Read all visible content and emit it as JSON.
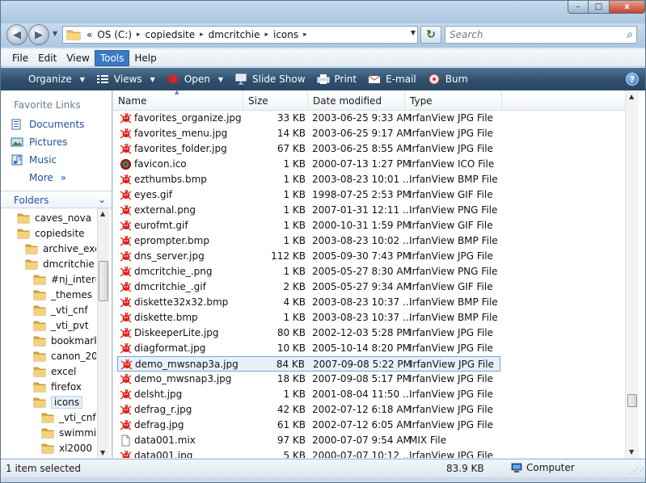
{
  "window": {
    "controls": {
      "minimize": "–",
      "maximize": "□",
      "close": "x"
    }
  },
  "nav": {
    "back_glyph": "◀",
    "forward_glyph": "▶",
    "recent_glyph": "▼",
    "breadcrumbs": [
      "«",
      "OS (C:)",
      "copiedsite",
      "dmcritchie",
      "icons"
    ],
    "crumb_sep": "▸",
    "address_dropdown": "▼",
    "refresh_glyph": "↻",
    "search_placeholder": "Search",
    "search_icon": "⌕"
  },
  "menu": {
    "items": [
      {
        "label": "File",
        "active": false
      },
      {
        "label": "Edit",
        "active": false
      },
      {
        "label": "View",
        "active": false
      },
      {
        "label": "Tools",
        "active": true
      },
      {
        "label": "Help",
        "active": false
      }
    ]
  },
  "commands": [
    {
      "label": "Organize",
      "icon": "organize-icon",
      "dropdown": true
    },
    {
      "label": "Views",
      "icon": "views-icon",
      "dropdown": true
    },
    {
      "label": "Open",
      "icon": "irfanview-icon",
      "dropdown": true
    },
    {
      "label": "Slide Show",
      "icon": "slideshow-icon",
      "dropdown": false
    },
    {
      "label": "Print",
      "icon": "printer-icon",
      "dropdown": false
    },
    {
      "label": "E-mail",
      "icon": "email-icon",
      "dropdown": false
    },
    {
      "label": "Burn",
      "icon": "burn-icon",
      "dropdown": false
    }
  ],
  "command_dropdown_glyph": "▼",
  "help_glyph": "?",
  "left": {
    "favorite_links_header": "Favorite Links",
    "favorite_links": [
      {
        "label": "Documents",
        "icon": "documents-icon"
      },
      {
        "label": "Pictures",
        "icon": "pictures-icon"
      },
      {
        "label": "Music",
        "icon": "music-icon"
      }
    ],
    "more_label": "More",
    "more_glyph": "»",
    "folders_header": "Folders",
    "folders_chevron": "⌄",
    "tree": [
      {
        "label": "caves_nova",
        "indent": 1,
        "selected": false
      },
      {
        "label": "copiedsite",
        "indent": 1,
        "selected": false
      },
      {
        "label": "archive_exc",
        "indent": 2,
        "selected": false
      },
      {
        "label": "dmcritchie",
        "indent": 2,
        "selected": false
      },
      {
        "label": "#nj_intere",
        "indent": 3,
        "selected": false
      },
      {
        "label": "_themes",
        "indent": 3,
        "selected": false
      },
      {
        "label": "_vti_cnf",
        "indent": 3,
        "selected": false
      },
      {
        "label": "_vti_pvt",
        "indent": 3,
        "selected": false
      },
      {
        "label": "bookmark",
        "indent": 3,
        "selected": false
      },
      {
        "label": "canon_20",
        "indent": 3,
        "selected": false
      },
      {
        "label": "excel",
        "indent": 3,
        "selected": false
      },
      {
        "label": "firefox",
        "indent": 3,
        "selected": false
      },
      {
        "label": "icons",
        "indent": 3,
        "selected": true
      },
      {
        "label": "_vti_cnf",
        "indent": 4,
        "selected": false
      },
      {
        "label": "swimmi",
        "indent": 4,
        "selected": false
      },
      {
        "label": "xl2000",
        "indent": 4,
        "selected": false
      }
    ]
  },
  "columns": [
    "Name",
    "Size",
    "Date modified",
    "Type"
  ],
  "sort_glyph": "▲",
  "files": [
    {
      "name": "favorites_organize.jpg",
      "size": "33 KB",
      "date": "2003-06-25 9:33 AM",
      "type": "IrfanView JPG File",
      "icon": "irfanview",
      "selected": false
    },
    {
      "name": "favorites_menu.jpg",
      "size": "14 KB",
      "date": "2003-06-25 9:17 AM",
      "type": "IrfanView JPG File",
      "icon": "irfanview",
      "selected": false
    },
    {
      "name": "favorites_folder.jpg",
      "size": "67 KB",
      "date": "2003-06-25 8:55 AM",
      "type": "IrfanView JPG File",
      "icon": "irfanview",
      "selected": false
    },
    {
      "name": "favicon.ico",
      "size": "1 KB",
      "date": "2000-07-13 1:27 PM",
      "type": "IrfanView ICO File",
      "icon": "ico",
      "selected": false
    },
    {
      "name": "ezthumbs.bmp",
      "size": "1 KB",
      "date": "2003-08-23 10:01 ...",
      "type": "IrfanView BMP File",
      "icon": "irfanview",
      "selected": false
    },
    {
      "name": "eyes.gif",
      "size": "1 KB",
      "date": "1998-07-25 2:53 PM",
      "type": "IrfanView GIF File",
      "icon": "irfanview",
      "selected": false
    },
    {
      "name": "external.png",
      "size": "1 KB",
      "date": "2007-01-31 12:11 ...",
      "type": "IrfanView PNG File",
      "icon": "irfanview",
      "selected": false
    },
    {
      "name": "eurofmt.gif",
      "size": "1 KB",
      "date": "2000-10-31 1:59 PM",
      "type": "IrfanView GIF File",
      "icon": "irfanview",
      "selected": false
    },
    {
      "name": "eprompter.bmp",
      "size": "1 KB",
      "date": "2003-08-23 10:02 ...",
      "type": "IrfanView BMP File",
      "icon": "irfanview",
      "selected": false
    },
    {
      "name": "dns_server.jpg",
      "size": "112 KB",
      "date": "2005-09-30 7:43 PM",
      "type": "IrfanView JPG File",
      "icon": "irfanview",
      "selected": false
    },
    {
      "name": "dmcritchie_.png",
      "size": "1 KB",
      "date": "2005-05-27 8:30 AM",
      "type": "IrfanView PNG File",
      "icon": "irfanview",
      "selected": false
    },
    {
      "name": "dmcritchie_.gif",
      "size": "2 KB",
      "date": "2005-05-27 9:34 AM",
      "type": "IrfanView GIF File",
      "icon": "irfanview",
      "selected": false
    },
    {
      "name": "diskette32x32.bmp",
      "size": "4 KB",
      "date": "2003-08-23 10:37 ...",
      "type": "IrfanView BMP File",
      "icon": "irfanview",
      "selected": false
    },
    {
      "name": "diskette.bmp",
      "size": "1 KB",
      "date": "2003-08-23 10:37 ...",
      "type": "IrfanView BMP File",
      "icon": "irfanview",
      "selected": false
    },
    {
      "name": "DiskeeperLite.jpg",
      "size": "80 KB",
      "date": "2002-12-03 5:28 PM",
      "type": "IrfanView JPG File",
      "icon": "irfanview",
      "selected": false
    },
    {
      "name": "diagformat.jpg",
      "size": "10 KB",
      "date": "2005-10-14 8:20 PM",
      "type": "IrfanView JPG File",
      "icon": "irfanview",
      "selected": false
    },
    {
      "name": "demo_mwsnap3a.jpg",
      "size": "84 KB",
      "date": "2007-09-08 5:22 PM",
      "type": "IrfanView JPG File",
      "icon": "irfanview",
      "selected": true
    },
    {
      "name": "demo_mwsnap3.jpg",
      "size": "18 KB",
      "date": "2007-09-08 5:17 PM",
      "type": "IrfanView JPG File",
      "icon": "irfanview",
      "selected": false
    },
    {
      "name": "delsht.jpg",
      "size": "1 KB",
      "date": "2001-08-04 11:50 ...",
      "type": "IrfanView JPG File",
      "icon": "irfanview",
      "selected": false
    },
    {
      "name": "defrag_r.jpg",
      "size": "42 KB",
      "date": "2002-07-12 6:18 AM",
      "type": "IrfanView JPG File",
      "icon": "irfanview",
      "selected": false
    },
    {
      "name": "defrag.jpg",
      "size": "61 KB",
      "date": "2002-07-12 6:05 AM",
      "type": "IrfanView JPG File",
      "icon": "irfanview",
      "selected": false
    },
    {
      "name": "data001.mix",
      "size": "97 KB",
      "date": "2000-07-07 9:54 AM",
      "type": "MIX File",
      "icon": "generic",
      "selected": false
    },
    {
      "name": "data001.jpg",
      "size": "5 KB",
      "date": "2000-07-07 10:12 ...",
      "type": "IrfanView JPG File",
      "icon": "irfanview",
      "selected": false
    }
  ],
  "status": {
    "selection": "1 item selected",
    "size": "83.9 KB",
    "location": "Computer"
  },
  "colors": {
    "irfan_red": "#e0231c",
    "link_blue": "#1d51a3",
    "command_bar": "#2f4f6c",
    "menu_active": "#3a79c6"
  }
}
